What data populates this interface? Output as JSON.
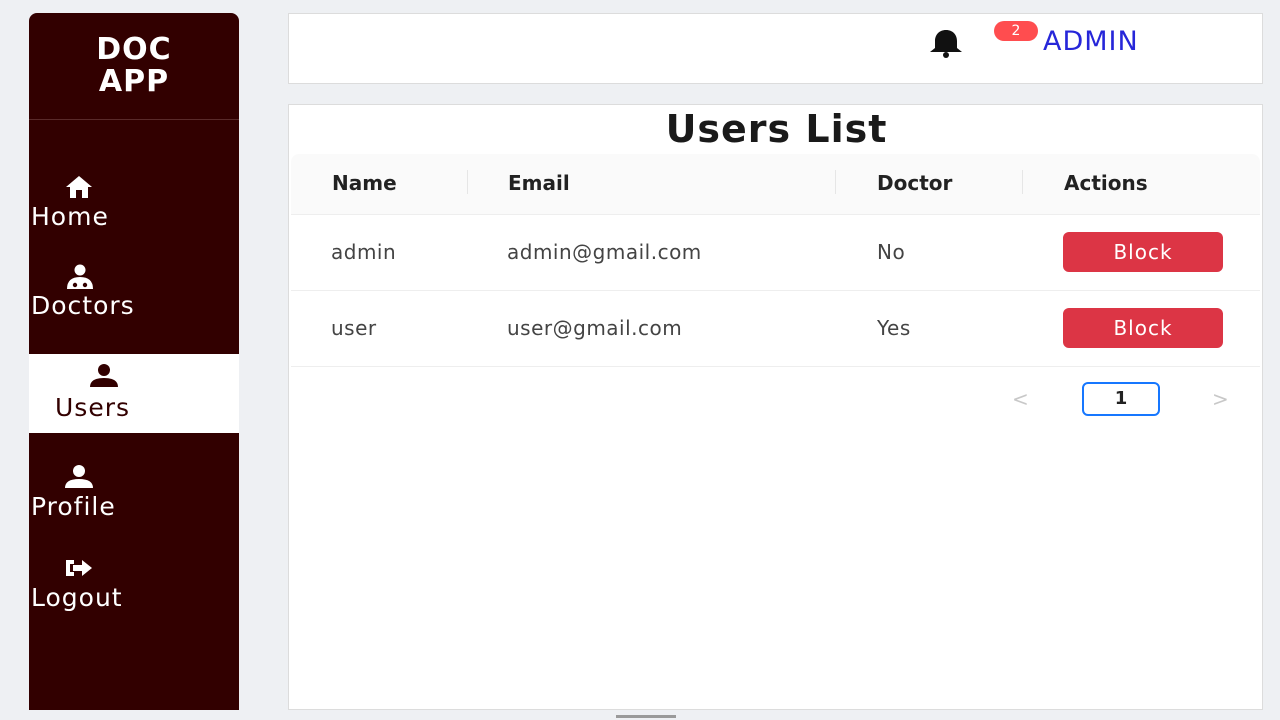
{
  "sidebar": {
    "logo_line1": "DOC",
    "logo_line2": "APP",
    "items": [
      {
        "label": "Home",
        "icon": "home-icon"
      },
      {
        "label": "Doctors",
        "icon": "doctor-icon"
      },
      {
        "label": "Users",
        "icon": "user-icon",
        "active": true
      },
      {
        "label": "Profile",
        "icon": "user-icon"
      },
      {
        "label": "Logout",
        "icon": "logout-icon"
      }
    ]
  },
  "header": {
    "notification_count": "2",
    "user_name": "ADMIN"
  },
  "main": {
    "title": "Users List",
    "columns": [
      "Name",
      "Email",
      "Doctor",
      "Actions"
    ],
    "rows": [
      {
        "name": "admin",
        "email": "admin@gmail.com",
        "doctor": "No",
        "action": "Block"
      },
      {
        "name": "user",
        "email": "user@gmail.com",
        "doctor": "Yes",
        "action": "Block"
      }
    ],
    "pagination": {
      "prev": "<",
      "current": "1",
      "next": ">"
    }
  },
  "colors": {
    "sidebar_bg": "#320000",
    "accent_button": "#dc3545",
    "badge": "#ff4d4f",
    "admin_link": "#2626d9"
  }
}
